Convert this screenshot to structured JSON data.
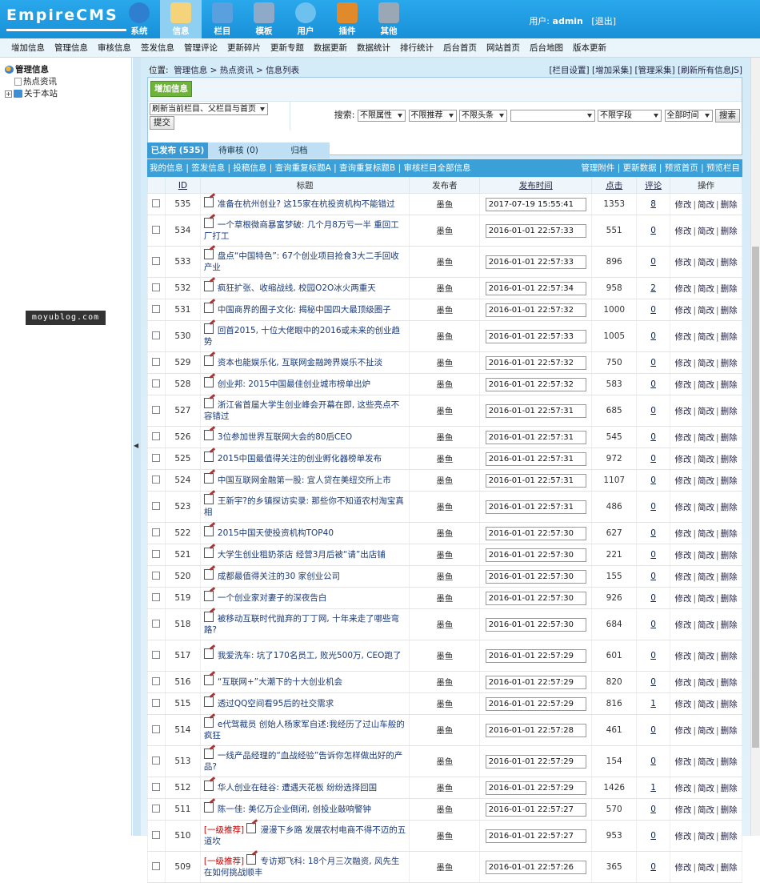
{
  "header": {
    "logo": "EmpireCMS",
    "nav": [
      {
        "label": "系统",
        "icon": "globe-icon",
        "color": "#2f7fd0"
      },
      {
        "label": "信息",
        "icon": "edit-document-icon",
        "color": "#f4d37a"
      },
      {
        "label": "栏目",
        "icon": "folder-icon",
        "color": "#5aa0df"
      },
      {
        "label": "模板",
        "icon": "template-window-icon",
        "color": "#8fa9c8"
      },
      {
        "label": "用户",
        "icon": "user-icon",
        "color": "#6cc1ef"
      },
      {
        "label": "插件",
        "icon": "tools-icon",
        "color": "#e08a2c"
      },
      {
        "label": "其他",
        "icon": "gear-icon",
        "color": "#9aa7b4"
      }
    ],
    "user_label": "用户:",
    "user_name": "admin",
    "logout": "[退出]"
  },
  "subnav": [
    "增加信息",
    "管理信息",
    "审核信息",
    "签发信息",
    "管理评论",
    "更新碎片",
    "更新专题",
    "数据更新",
    "数据统计",
    "排行统计",
    "后台首页",
    "网站首页",
    "后台地图",
    "版本更新"
  ],
  "sidebar": {
    "root": "管理信息",
    "items": [
      "热点资讯",
      "关于本站"
    ]
  },
  "watermark": "moyublog.com",
  "crumb": {
    "label": "位置:",
    "path": "管理信息 > 热点资讯 > 信息列表",
    "links": "[栏目设置] [增加采集] [管理采集] [刷新所有信息JS]"
  },
  "toolbar": {
    "add_button": "增加信息",
    "refresh_select": "刷新当前栏目、父栏目与首页",
    "submit": "提交",
    "search_label": "搜索:",
    "filter_attr": "不限属性",
    "filter_rec": "不限推荐",
    "filter_head": "不限头条",
    "field": "不限字段",
    "time": "全部时间",
    "search_button": "搜索"
  },
  "tabs": [
    "已发布 (535)",
    "待审核 (0)",
    "归档"
  ],
  "listbar": {
    "left": "我的信息 | 签发信息 | 投稿信息 | 查询重复标题A | 查询重复标题B | 审核栏目全部信息",
    "right": "管理附件 | 更新数据 | 预览首页 | 预览栏目"
  },
  "table": {
    "headers": [
      "",
      "ID",
      "标题",
      "发布者",
      "发布时间",
      "点击",
      "评论",
      "操作"
    ],
    "op_edit": "修改",
    "op_simple": "简改",
    "op_delete": "删除",
    "rows": [
      {
        "id": "535",
        "title": "准备在杭州创业? 这15家在杭投资机构不能错过",
        "tag": "",
        "author": "墨鱼",
        "time": "2017-07-19 15:55:41",
        "clicks": "1353",
        "comments": "8"
      },
      {
        "id": "534",
        "title": "一个草根微商暴富梦破: 几个月8万亏一半 重回工厂打工",
        "tag": "",
        "author": "墨鱼",
        "time": "2016-01-01 22:57:33",
        "clicks": "551",
        "comments": "0"
      },
      {
        "id": "533",
        "title": "盘点“中国特色”: 67个创业项目抢食3大二手回收产业",
        "tag": "",
        "author": "墨鱼",
        "time": "2016-01-01 22:57:33",
        "clicks": "896",
        "comments": "0"
      },
      {
        "id": "532",
        "title": "疯狂扩张、收缩战线, 校园O2O冰火两重天",
        "tag": "",
        "author": "墨鱼",
        "time": "2016-01-01 22:57:34",
        "clicks": "958",
        "comments": "2"
      },
      {
        "id": "531",
        "title": "中国商界的圈子文化: 揭秘中国四大最顶级圈子",
        "tag": "",
        "author": "墨鱼",
        "time": "2016-01-01 22:57:32",
        "clicks": "1000",
        "comments": "0"
      },
      {
        "id": "530",
        "title": "回首2015, 十位大佬眼中的2016或未来的创业趋势",
        "tag": "",
        "author": "墨鱼",
        "time": "2016-01-01 22:57:33",
        "clicks": "1005",
        "comments": "0"
      },
      {
        "id": "529",
        "title": "资本也能娱乐化, 互联网金融跨界娱乐不扯淡",
        "tag": "",
        "author": "墨鱼",
        "time": "2016-01-01 22:57:32",
        "clicks": "750",
        "comments": "0"
      },
      {
        "id": "528",
        "title": "创业邦: 2015中国最佳创业城市榜单出炉",
        "tag": "",
        "author": "墨鱼",
        "time": "2016-01-01 22:57:32",
        "clicks": "583",
        "comments": "0"
      },
      {
        "id": "527",
        "title": "浙江省首届大学生创业峰会开幕在即, 这些亮点不容错过",
        "tag": "",
        "author": "墨鱼",
        "time": "2016-01-01 22:57:31",
        "clicks": "685",
        "comments": "0"
      },
      {
        "id": "526",
        "title": "3位参加世界互联网大会的80后CEO",
        "tag": "",
        "author": "墨鱼",
        "time": "2016-01-01 22:57:31",
        "clicks": "545",
        "comments": "0"
      },
      {
        "id": "525",
        "title": "2015中国最值得关注的创业孵化器榜单发布",
        "tag": "",
        "author": "墨鱼",
        "time": "2016-01-01 22:57:31",
        "clicks": "972",
        "comments": "0"
      },
      {
        "id": "524",
        "title": "中国互联网金融第一股: 宜人贷在美纽交所上市",
        "tag": "",
        "author": "墨鱼",
        "time": "2016-01-01 22:57:31",
        "clicks": "1107",
        "comments": "0"
      },
      {
        "id": "523",
        "title": "王新宇?的乡镇探访实录: 那些你不知道农村淘宝真相",
        "tag": "",
        "author": "墨鱼",
        "time": "2016-01-01 22:57:31",
        "clicks": "486",
        "comments": "0"
      },
      {
        "id": "522",
        "title": "2015中国天使投资机构TOP40",
        "tag": "",
        "author": "墨鱼",
        "time": "2016-01-01 22:57:30",
        "clicks": "627",
        "comments": "0"
      },
      {
        "id": "521",
        "title": "大学生创业租奶茶店 经营3月后被“请”出店铺",
        "tag": "",
        "author": "墨鱼",
        "time": "2016-01-01 22:57:30",
        "clicks": "221",
        "comments": "0"
      },
      {
        "id": "520",
        "title": "成都最值得关注的30 家创业公司",
        "tag": "",
        "author": "墨鱼",
        "time": "2016-01-01 22:57:30",
        "clicks": "155",
        "comments": "0"
      },
      {
        "id": "519",
        "title": "一个创业家对妻子的深夜告白",
        "tag": "",
        "author": "墨鱼",
        "time": "2016-01-01 22:57:30",
        "clicks": "926",
        "comments": "0"
      },
      {
        "id": "518",
        "title": "被移动互联时代抛弃的丁丁网, 十年来走了哪些弯路?",
        "tag": "",
        "author": "墨鱼",
        "time": "2016-01-01 22:57:30",
        "clicks": "684",
        "comments": "0"
      },
      {
        "id": "517",
        "title": "我爱洗车: 坑了170名员工, 败光500万, CEO跑了",
        "tag": "",
        "author": "墨鱼",
        "time": "2016-01-01 22:57:29",
        "clicks": "601",
        "comments": "0"
      },
      {
        "id": "516",
        "title": "“互联网+”大潮下的十大创业机会",
        "tag": "",
        "author": "墨鱼",
        "time": "2016-01-01 22:57:29",
        "clicks": "820",
        "comments": "0"
      },
      {
        "id": "515",
        "title": "透过QQ空间看95后的社交需求",
        "tag": "",
        "author": "墨鱼",
        "time": "2016-01-01 22:57:29",
        "clicks": "816",
        "comments": "1"
      },
      {
        "id": "514",
        "title": "e代驾裁员 创始人杨家军自述:我经历了过山车般的疯狂",
        "tag": "",
        "author": "墨鱼",
        "time": "2016-01-01 22:57:28",
        "clicks": "461",
        "comments": "0"
      },
      {
        "id": "513",
        "title": "一线产品经理的“血战经验”告诉你怎样做出好的产品?",
        "tag": "",
        "author": "墨鱼",
        "time": "2016-01-01 22:57:29",
        "clicks": "154",
        "comments": "0"
      },
      {
        "id": "512",
        "title": "华人创业在硅谷: 遭遇天花板 纷纷选择回国",
        "tag": "",
        "author": "墨鱼",
        "time": "2016-01-01 22:57:29",
        "clicks": "1426",
        "comments": "1"
      },
      {
        "id": "511",
        "title": "陈一佳: 美亿万企业倒闭, 创投业敲响警钟",
        "tag": "",
        "author": "墨鱼",
        "time": "2016-01-01 22:57:27",
        "clicks": "570",
        "comments": "0"
      },
      {
        "id": "510",
        "title": "漫漫下乡路 发展农村电商不得不迈的五道坎",
        "tag": "[一级推荐]",
        "author": "墨鱼",
        "time": "2016-01-01 22:57:27",
        "clicks": "953",
        "comments": "0"
      },
      {
        "id": "509",
        "title": "专访郑飞科: 18个月三次融资, 风先生在如何挑战顺丰",
        "tag": "[一级推荐]",
        "author": "墨鱼",
        "time": "2016-01-01 22:57:26",
        "clicks": "365",
        "comments": "0"
      }
    ]
  }
}
